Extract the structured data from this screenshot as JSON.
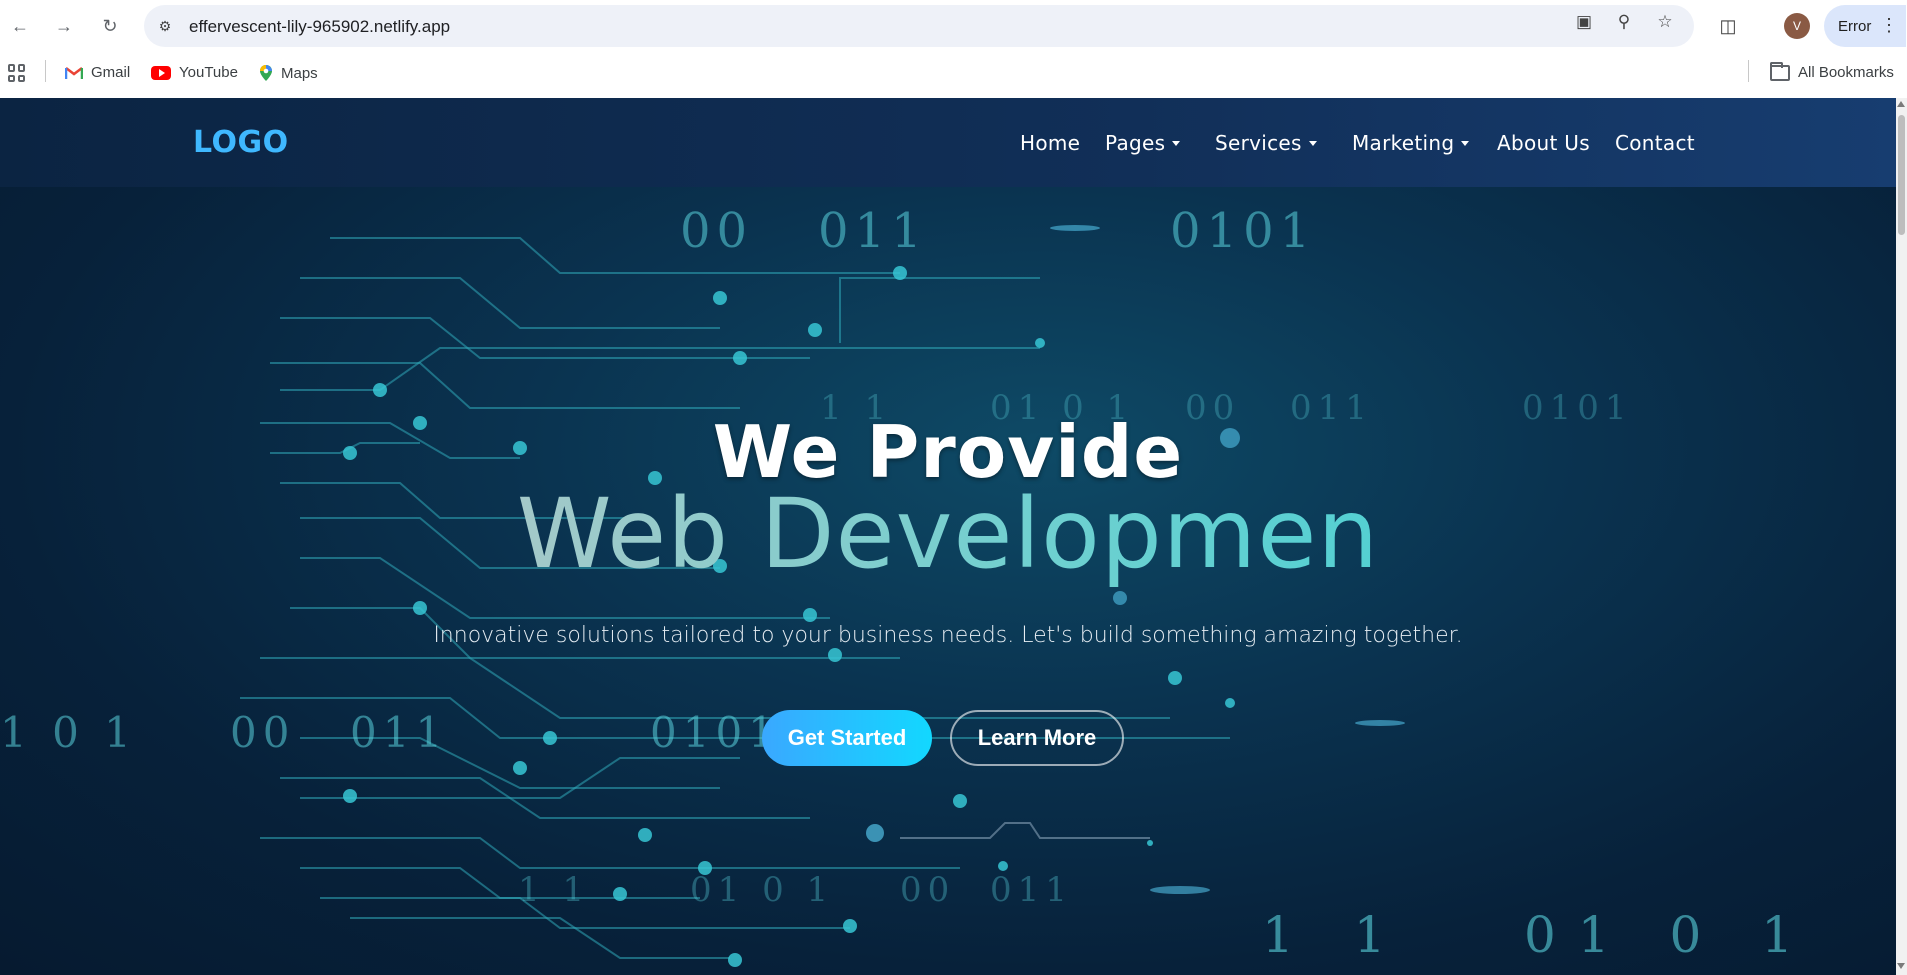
{
  "browser": {
    "url": "effervescent-lily-965902.netlify.app",
    "avatar_initial": "V",
    "error_label": "Error",
    "bookmarks": [
      {
        "label": "Gmail",
        "icon": "gmail-icon"
      },
      {
        "label": "YouTube",
        "icon": "youtube-icon"
      },
      {
        "label": "Maps",
        "icon": "maps-icon"
      }
    ],
    "all_bookmarks_label": "All Bookmarks"
  },
  "site": {
    "logo": "LOGO",
    "nav": [
      {
        "label": "Home",
        "dropdown": false
      },
      {
        "label": "Pages",
        "dropdown": true
      },
      {
        "label": "Services",
        "dropdown": true
      },
      {
        "label": "Marketing",
        "dropdown": true
      },
      {
        "label": "About Us",
        "dropdown": false
      },
      {
        "label": "Contact",
        "dropdown": false
      }
    ],
    "hero": {
      "title_line1": "We Provide",
      "title_line2": "Web Developmen",
      "subtitle": "Innovative solutions tailored to your business needs. Let's build something amazing together.",
      "primary_button": "Get Started",
      "secondary_button": "Learn More"
    },
    "background_binary": [
      "00",
      "011",
      "0101",
      "1 1",
      "01 0 1",
      "00",
      "011",
      "0101",
      "1 0 1",
      "00",
      "011",
      "0101",
      "1 1",
      "01 0 1",
      "00",
      "011",
      "1 1",
      "01 0 1"
    ]
  },
  "colors": {
    "logo": "#3fb8ff",
    "accent_gradient_start": "#3aa8ff",
    "accent_gradient_end": "#12d8ff",
    "title_gradient_end": "#2ad0d6"
  }
}
